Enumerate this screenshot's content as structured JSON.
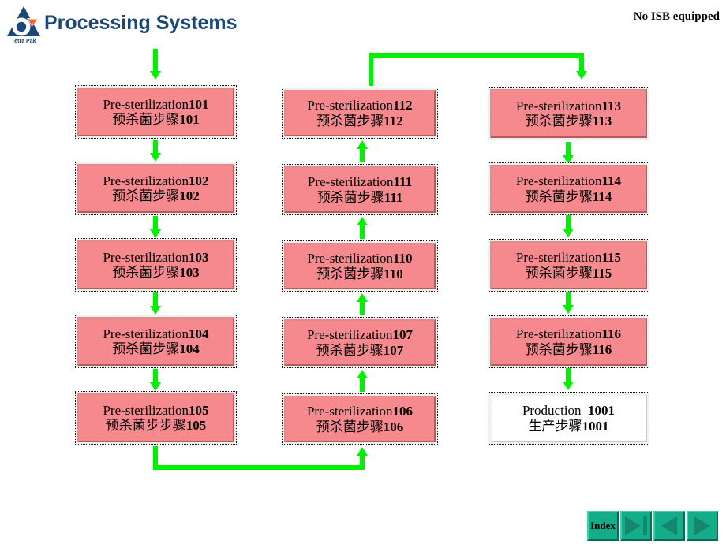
{
  "header": {
    "title": "Processing Systems",
    "note": "No ISB equipped",
    "logo_icon": "tetra-pak-logo-icon",
    "logo_wordmark": "Tetra Pak"
  },
  "colors": {
    "title_blue": "#1b4878",
    "node_fill": "#f5898e",
    "node_border": "#111111",
    "arrow_green": "#00f000",
    "nav_teal": "#14ad8a",
    "nav_glyph": "#15876e",
    "white_node_fill": "#ffffff"
  },
  "diagram": {
    "columns": [
      {
        "id": "column-left",
        "nodes": [
          {
            "en": "Pre-sterilization",
            "num": "101",
            "zh": "预杀菌步骤",
            "variant": "pink"
          },
          {
            "en": "Pre-sterilization",
            "num": "102",
            "zh": "预杀菌步骤",
            "variant": "pink"
          },
          {
            "en": "Pre-sterilization",
            "num": "103",
            "zh": "预杀菌步骤",
            "variant": "pink"
          },
          {
            "en": "Pre-sterilization",
            "num": "104",
            "zh": "预杀菌步骤",
            "variant": "pink"
          },
          {
            "en": "Pre-sterilization",
            "num": "105",
            "zh": "预杀菌步步骤",
            "variant": "pink"
          }
        ]
      },
      {
        "id": "column-middle",
        "nodes": [
          {
            "en": "Pre-sterilization",
            "num": "112",
            "zh": "预杀菌步骤",
            "variant": "pink"
          },
          {
            "en": "Pre-sterilization",
            "num": "111",
            "zh": "预杀菌步骤",
            "variant": "pink"
          },
          {
            "en": "Pre-sterilization",
            "num": "110",
            "zh": "预杀菌步骤",
            "variant": "pink"
          },
          {
            "en": "Pre-sterilization",
            "num": "107",
            "zh": "预杀菌步骤",
            "variant": "pink"
          },
          {
            "en": "Pre-sterilization",
            "num": "106",
            "zh": "预杀菌步骤",
            "variant": "pink"
          }
        ]
      },
      {
        "id": "column-right",
        "nodes": [
          {
            "en": "Pre-sterilization",
            "num": "113",
            "zh": "预杀菌步骤",
            "variant": "pink"
          },
          {
            "en": "Pre-sterilization",
            "num": "114",
            "zh": "预杀菌步骤",
            "variant": "pink"
          },
          {
            "en": "Pre-sterilization",
            "num": "115",
            "zh": "预杀菌步骤",
            "variant": "pink"
          },
          {
            "en": "Pre-sterilization",
            "num": "116",
            "zh": "预杀菌步骤",
            "variant": "pink"
          },
          {
            "en": "Production  ",
            "num": "1001",
            "zh": "生产步骤",
            "variant": "white"
          }
        ]
      }
    ]
  },
  "nav": {
    "index_label": "Index",
    "buttons": [
      {
        "name": "index-button",
        "kind": "text",
        "label": "Index"
      },
      {
        "name": "last-slide-button",
        "kind": "triangle-right-bar",
        "label": ""
      },
      {
        "name": "previous-slide-button",
        "kind": "triangle-left",
        "label": ""
      },
      {
        "name": "next-slide-button",
        "kind": "triangle-right",
        "label": ""
      }
    ]
  }
}
